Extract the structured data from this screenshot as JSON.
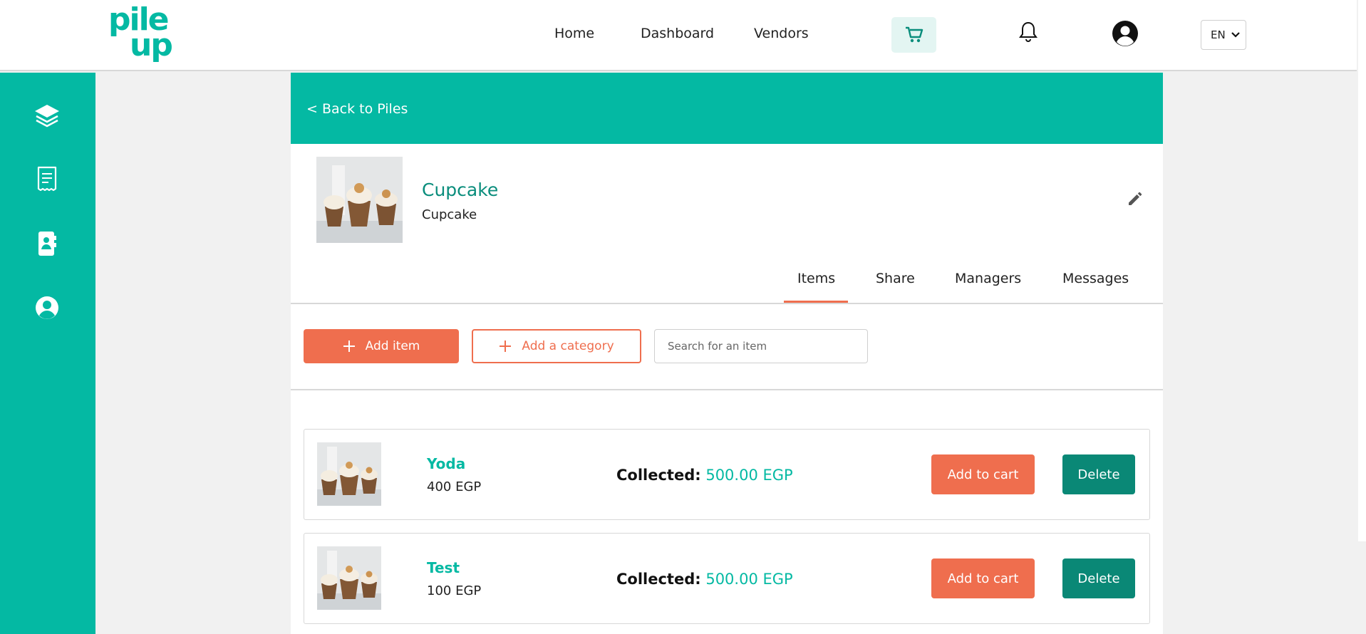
{
  "brand": {
    "logo_line1": "pile",
    "logo_line2": "up"
  },
  "nav": {
    "home": "Home",
    "dashboard": "Dashboard",
    "vendors": "Vendors"
  },
  "header_icons": {
    "cart": "cart-icon",
    "notifications": "bell-icon",
    "account": "user-circle-icon"
  },
  "language": {
    "selected": "EN"
  },
  "sidebar": {
    "items": [
      "layers-icon",
      "receipt-icon",
      "contacts-book-icon",
      "user-circle-icon"
    ]
  },
  "banner": {
    "back_label": "< Back to Piles"
  },
  "pile": {
    "name": "Cupcake",
    "description": "Cupcake",
    "edit_icon": "pencil-icon"
  },
  "tabs": {
    "items": "Items",
    "share": "Share",
    "managers": "Managers",
    "messages": "Messages",
    "active": "Items"
  },
  "actions": {
    "add_item": "Add item",
    "add_category": "Add a category",
    "search_placeholder": "Search for an item"
  },
  "list_items": [
    {
      "name": "Yoda",
      "price": "400 EGP",
      "collected_label": "Collected:",
      "collected_value": "500.00 EGP",
      "add_to_cart": "Add to cart",
      "delete": "Delete"
    },
    {
      "name": "Test",
      "price": "100 EGP",
      "collected_label": "Collected:",
      "collected_value": "500.00 EGP",
      "add_to_cart": "Add to cart",
      "delete": "Delete"
    }
  ],
  "colors": {
    "primary": "#04b9a3",
    "accent": "#ef6e4e",
    "dark_teal": "#0a8876"
  }
}
